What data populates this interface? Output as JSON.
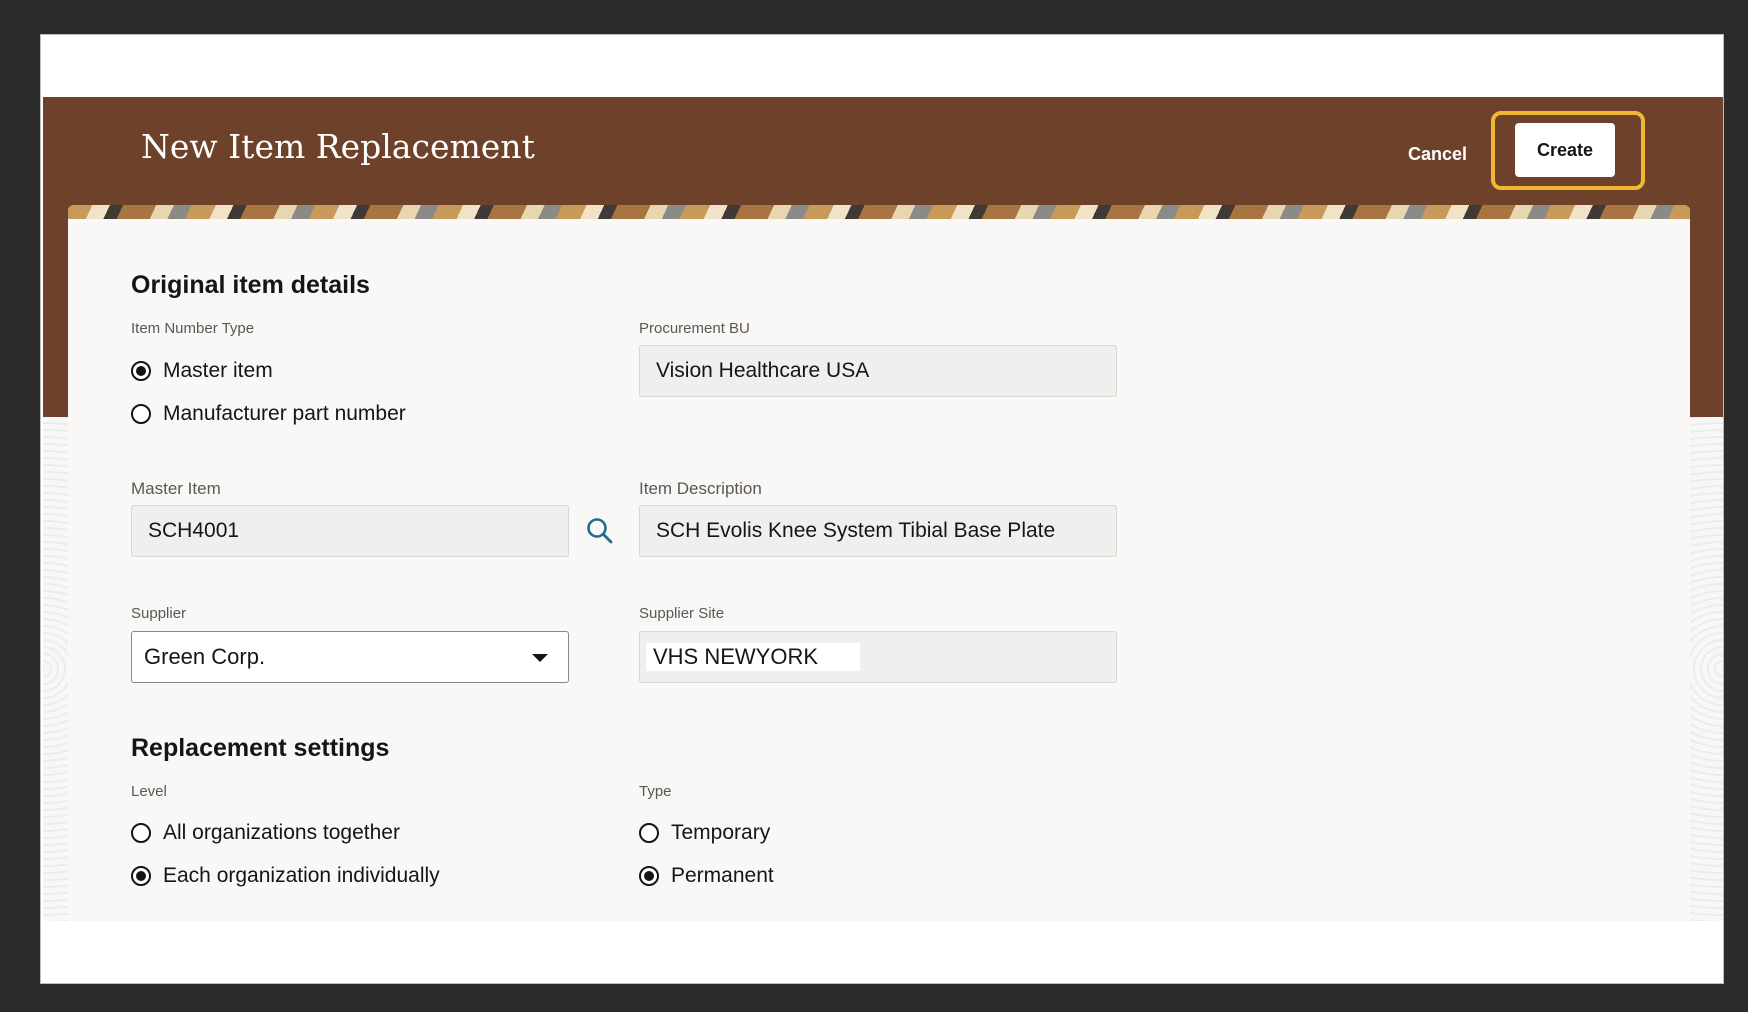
{
  "header": {
    "title": "New Item Replacement",
    "cancel_label": "Cancel",
    "create_label": "Create"
  },
  "original_item_details": {
    "heading": "Original item details",
    "item_number_type": {
      "label": "Item Number Type",
      "options": [
        {
          "label": "Master item",
          "selected": true
        },
        {
          "label": "Manufacturer part number",
          "selected": false
        }
      ]
    },
    "procurement_bu": {
      "label": "Procurement BU",
      "value": "Vision Healthcare USA"
    },
    "master_item": {
      "label": "Master Item",
      "value": "SCH4001"
    },
    "item_description": {
      "label": "Item Description",
      "value": "SCH Evolis Knee System Tibial Base Plate"
    },
    "supplier": {
      "label": "Supplier",
      "value": "Green Corp."
    },
    "supplier_site": {
      "label": "Supplier Site",
      "value": "VHS NEWYORK"
    }
  },
  "replacement_settings": {
    "heading": "Replacement settings",
    "level": {
      "label": "Level",
      "options": [
        {
          "label": "All organizations together",
          "selected": false
        },
        {
          "label": "Each organization individually",
          "selected": true
        }
      ]
    },
    "type": {
      "label": "Type",
      "options": [
        {
          "label": "Temporary",
          "selected": false
        },
        {
          "label": "Permanent",
          "selected": true
        }
      ]
    }
  },
  "colors": {
    "header_band": "#6d412a",
    "focus_ring": "#f1b732",
    "search_icon": "#1f6e8c"
  }
}
